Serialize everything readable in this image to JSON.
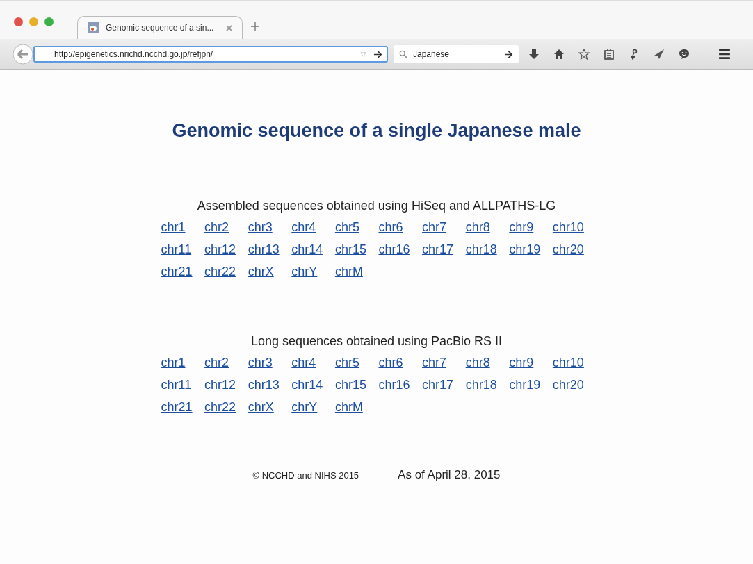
{
  "browser": {
    "tabs": [
      {
        "title": "Genomic sequence of a sin...",
        "selected": true
      }
    ],
    "address": {
      "value": "http://epigenetics.nrichd.ncchd.go.jp/refjpn/"
    },
    "search": {
      "value": "Japanese"
    }
  },
  "page": {
    "title": "Genomic sequence of a single Japanese male",
    "sections": [
      {
        "heading": "Assembled sequences obtained using HiSeq and ALLPATHS-LG",
        "links": [
          "chr1",
          "chr2",
          "chr3",
          "chr4",
          "chr5",
          "chr6",
          "chr7",
          "chr8",
          "chr9",
          "chr10",
          "chr11",
          "chr12",
          "chr13",
          "chr14",
          "chr15",
          "chr16",
          "chr17",
          "chr18",
          "chr19",
          "chr20",
          "chr21",
          "chr22",
          "chrX",
          "chrY",
          "chrM"
        ]
      },
      {
        "heading": "Long sequences obtained using PacBio RS II",
        "links": [
          "chr1",
          "chr2",
          "chr3",
          "chr4",
          "chr5",
          "chr6",
          "chr7",
          "chr8",
          "chr9",
          "chr10",
          "chr11",
          "chr12",
          "chr13",
          "chr14",
          "chr15",
          "chr16",
          "chr17",
          "chr18",
          "chr19",
          "chr20",
          "chr21",
          "chr22",
          "chrX",
          "chrY",
          "chrM"
        ]
      }
    ],
    "footer": {
      "copyright": "© NCCHD and NIHS 2015",
      "date": "As of April 28, 2015"
    }
  }
}
